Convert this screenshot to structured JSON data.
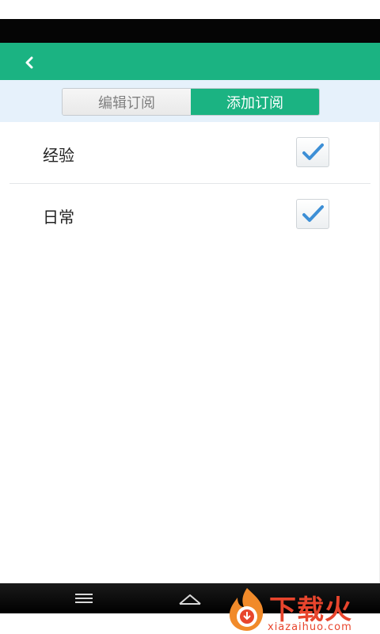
{
  "header": {
    "back_icon": "chevron-left-icon",
    "accent_color": "#1bb382"
  },
  "tabs": [
    {
      "label": "编辑订阅",
      "active": false
    },
    {
      "label": "添加订阅",
      "active": true
    }
  ],
  "subscriptions": [
    {
      "label": "经验",
      "checked": true
    },
    {
      "label": "日常",
      "checked": true
    }
  ],
  "navigation": {
    "menu_icon": "menu-icon",
    "home_icon": "home-icon"
  },
  "watermark": {
    "title": "下载火",
    "url": "xiazaihuo.com",
    "color": "#e8452d"
  }
}
